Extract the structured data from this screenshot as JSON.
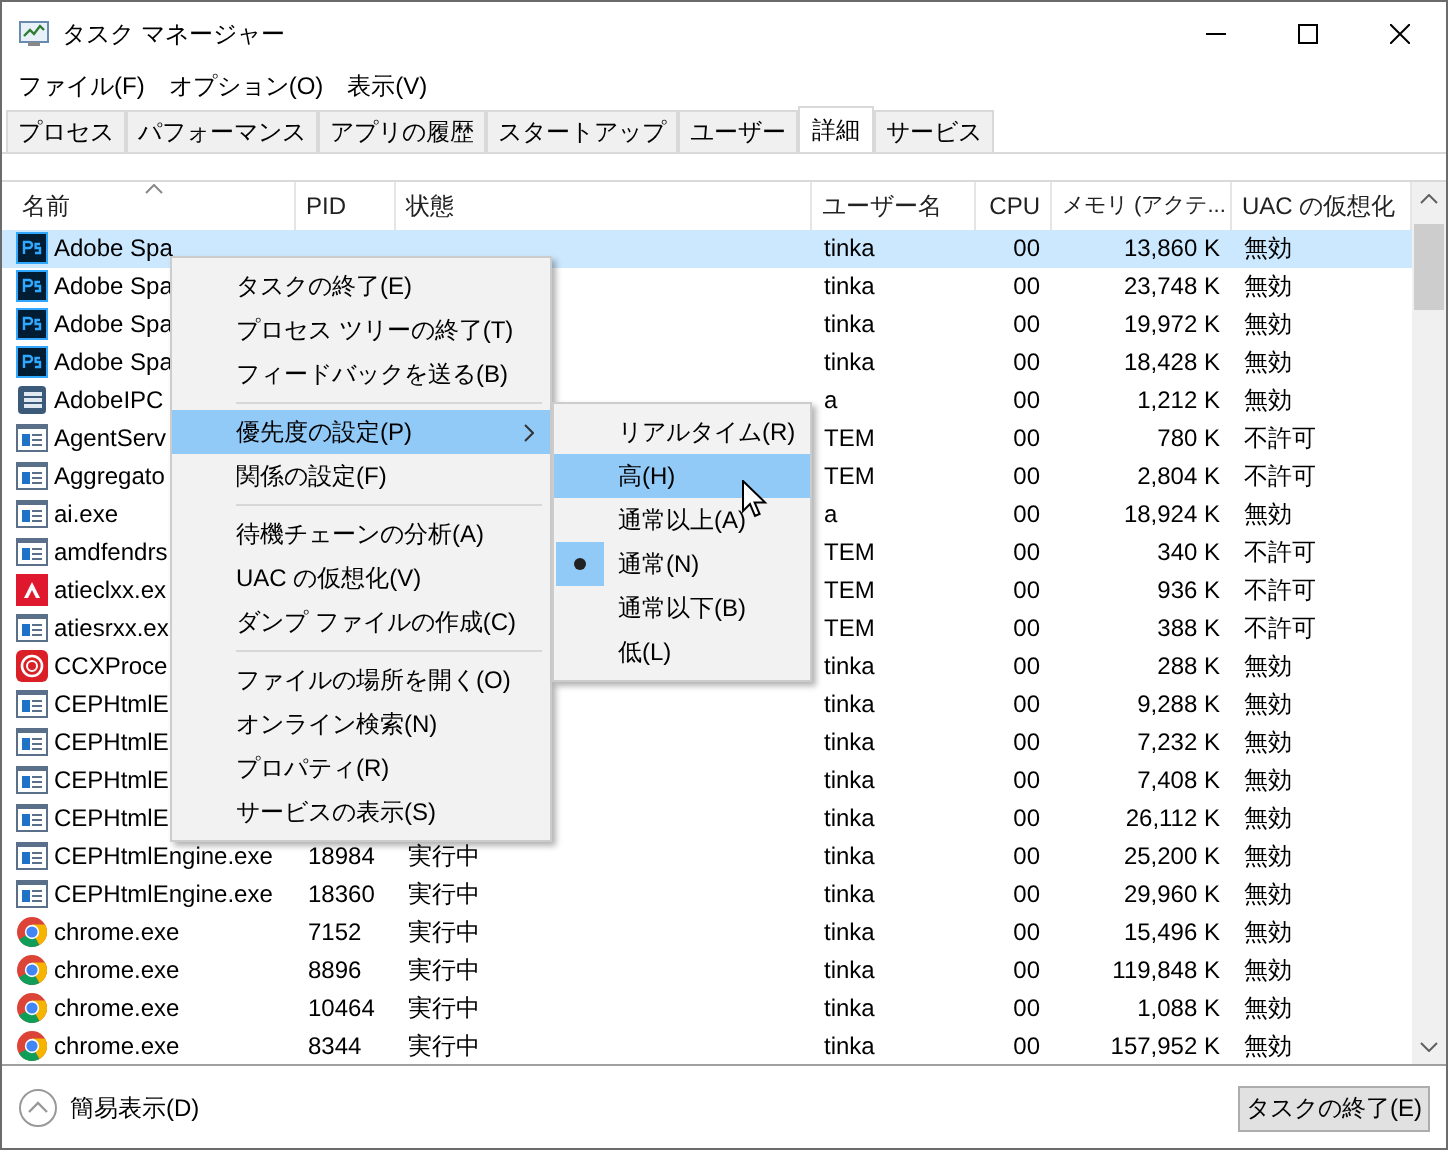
{
  "window": {
    "title": "タスク マネージャー"
  },
  "menu_bar": [
    "ファイル(F)",
    "オプション(O)",
    "表示(V)"
  ],
  "tabs": [
    {
      "label": "プロセス",
      "selected": false
    },
    {
      "label": "パフォーマンス",
      "selected": false
    },
    {
      "label": "アプリの履歴",
      "selected": false
    },
    {
      "label": "スタートアップ",
      "selected": false
    },
    {
      "label": "ユーザー",
      "selected": false
    },
    {
      "label": "詳細",
      "selected": true
    },
    {
      "label": "サービス",
      "selected": false
    }
  ],
  "table": {
    "columns": [
      {
        "label": "名前",
        "sorted": true
      },
      {
        "label": "PID",
        "sorted": false
      },
      {
        "label": "状態",
        "sorted": false
      },
      {
        "label": "ユーザー名",
        "sorted": false
      },
      {
        "label": "CPU",
        "sorted": false
      },
      {
        "label": "メモリ (アクテ...",
        "sorted": false
      },
      {
        "label": "UAC の仮想化",
        "sorted": false
      }
    ],
    "rows": [
      {
        "kind": "ps",
        "selected": true,
        "cells": [
          "Adobe Spa",
          "",
          "",
          "tinka",
          "00",
          "13,860 K",
          "無効"
        ]
      },
      {
        "kind": "ps",
        "selected": false,
        "cells": [
          "Adobe Spa",
          "",
          "",
          "tinka",
          "00",
          "23,748 K",
          "無効"
        ]
      },
      {
        "kind": "ps",
        "selected": false,
        "cells": [
          "Adobe Spa",
          "",
          "",
          "tinka",
          "00",
          "19,972 K",
          "無効"
        ]
      },
      {
        "kind": "ps",
        "selected": false,
        "cells": [
          "Adobe Spa",
          "",
          "",
          "tinka",
          "00",
          "18,428 K",
          "無効"
        ]
      },
      {
        "kind": "stack",
        "selected": false,
        "cells": [
          "AdobeIPC",
          "",
          "",
          "a",
          "00",
          "1,212 K",
          "無効"
        ]
      },
      {
        "kind": "window",
        "selected": false,
        "cells": [
          "AgentServ",
          "",
          "",
          "TEM",
          "00",
          "780 K",
          "不許可"
        ]
      },
      {
        "kind": "window",
        "selected": false,
        "cells": [
          "Aggregato",
          "",
          "",
          "TEM",
          "00",
          "2,804 K",
          "不許可"
        ]
      },
      {
        "kind": "window",
        "selected": false,
        "cells": [
          "ai.exe",
          "",
          "",
          "a",
          "00",
          "18,924 K",
          "無効"
        ]
      },
      {
        "kind": "window",
        "selected": false,
        "cells": [
          "amdfendrs",
          "",
          "",
          "TEM",
          "00",
          "340 K",
          "不許可"
        ]
      },
      {
        "kind": "amd",
        "selected": false,
        "cells": [
          "atieclxx.ex",
          "",
          "",
          "TEM",
          "00",
          "936 K",
          "不許可"
        ]
      },
      {
        "kind": "window",
        "selected": false,
        "cells": [
          "atiesrxx.ex",
          "",
          "",
          "TEM",
          "00",
          "388 K",
          "不許可"
        ]
      },
      {
        "kind": "cc",
        "selected": false,
        "cells": [
          "CCXProce",
          "",
          "",
          "tinka",
          "00",
          "288 K",
          "無効"
        ]
      },
      {
        "kind": "window",
        "selected": false,
        "cells": [
          "CEPHtmlE",
          "",
          "",
          "tinka",
          "00",
          "9,288 K",
          "無効"
        ]
      },
      {
        "kind": "window",
        "selected": false,
        "cells": [
          "CEPHtmlE",
          "",
          "",
          "tinka",
          "00",
          "7,232 K",
          "無効"
        ]
      },
      {
        "kind": "window",
        "selected": false,
        "cells": [
          "CEPHtmlE",
          "",
          "",
          "tinka",
          "00",
          "7,408 K",
          "無効"
        ]
      },
      {
        "kind": "window",
        "selected": false,
        "cells": [
          "CEPHtmlE",
          "",
          "",
          "tinka",
          "00",
          "26,112 K",
          "無効"
        ]
      },
      {
        "kind": "window",
        "selected": false,
        "cells": [
          "CEPHtmlEngine.exe",
          "18984",
          "実行中",
          "tinka",
          "00",
          "25,200 K",
          "無効"
        ]
      },
      {
        "kind": "window",
        "selected": false,
        "cells": [
          "CEPHtmlEngine.exe",
          "18360",
          "実行中",
          "tinka",
          "00",
          "29,960 K",
          "無効"
        ]
      },
      {
        "kind": "chrome",
        "selected": false,
        "cells": [
          "chrome.exe",
          "7152",
          "実行中",
          "tinka",
          "00",
          "15,496 K",
          "無効"
        ]
      },
      {
        "kind": "chrome",
        "selected": false,
        "cells": [
          "chrome.exe",
          "8896",
          "実行中",
          "tinka",
          "00",
          "119,848 K",
          "無効"
        ]
      },
      {
        "kind": "chrome",
        "selected": false,
        "cells": [
          "chrome.exe",
          "10464",
          "実行中",
          "tinka",
          "00",
          "1,088 K",
          "無効"
        ]
      },
      {
        "kind": "chrome",
        "selected": false,
        "cells": [
          "chrome.exe",
          "8344",
          "実行中",
          "tinka",
          "00",
          "157,952 K",
          "無効"
        ]
      }
    ]
  },
  "context_menu": {
    "groups": [
      [
        {
          "label": "タスクの終了(E)",
          "highlighted": false,
          "submenu": false
        },
        {
          "label": "プロセス ツリーの終了(T)",
          "highlighted": false,
          "submenu": false
        },
        {
          "label": "フィードバックを送る(B)",
          "highlighted": false,
          "submenu": false
        }
      ],
      [
        {
          "label": "優先度の設定(P)",
          "highlighted": true,
          "submenu": true
        },
        {
          "label": "関係の設定(F)",
          "highlighted": false,
          "submenu": false
        }
      ],
      [
        {
          "label": "待機チェーンの分析(A)",
          "highlighted": false,
          "submenu": false
        },
        {
          "label": "UAC の仮想化(V)",
          "highlighted": false,
          "submenu": false
        },
        {
          "label": "ダンプ ファイルの作成(C)",
          "highlighted": false,
          "submenu": false
        }
      ],
      [
        {
          "label": "ファイルの場所を開く(O)",
          "highlighted": false,
          "submenu": false
        },
        {
          "label": "オンライン検索(N)",
          "highlighted": false,
          "submenu": false
        },
        {
          "label": "プロパティ(R)",
          "highlighted": false,
          "submenu": false
        },
        {
          "label": "サービスの表示(S)",
          "highlighted": false,
          "submenu": false
        }
      ]
    ]
  },
  "priority_submenu": [
    {
      "label": "リアルタイム(R)",
      "highlighted": false,
      "checked": false
    },
    {
      "label": "高(H)",
      "highlighted": true,
      "checked": false
    },
    {
      "label": "通常以上(A)",
      "highlighted": false,
      "checked": false
    },
    {
      "label": "通常(N)",
      "highlighted": false,
      "checked": true
    },
    {
      "label": "通常以下(B)",
      "highlighted": false,
      "checked": false
    },
    {
      "label": "低(L)",
      "highlighted": false,
      "checked": false
    }
  ],
  "footer": {
    "toggle": "簡易表示(D)",
    "button": "タスクの終了(E)"
  }
}
